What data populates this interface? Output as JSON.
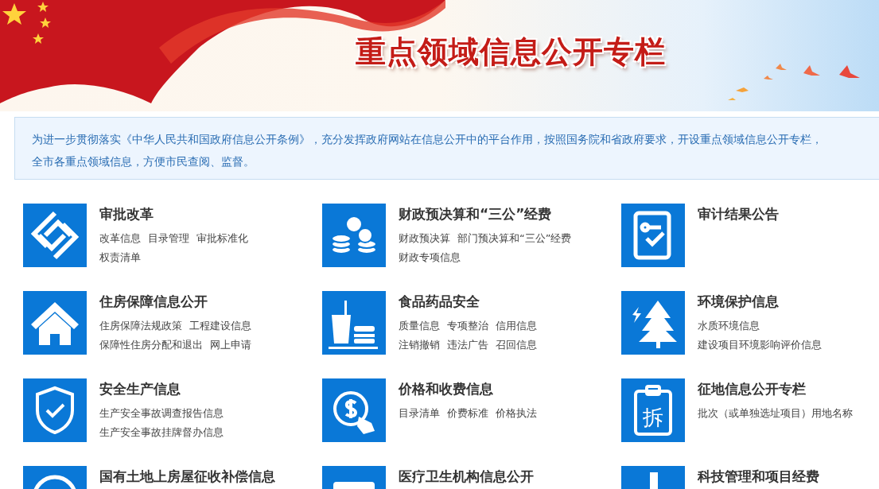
{
  "banner": {
    "title": "重点领域信息公开专栏"
  },
  "intro": {
    "lines": [
      "为进一步贯彻落实《中华人民共和国政府信息公开条例》，充分发挥政府网站在信息公开中的平台作用，按照国务院和省政府要求，开设重点领域信息公开专栏，",
      "全市各重点领域信息，方便市民查阅、监督。"
    ]
  },
  "sections": [
    {
      "title": "审批改革",
      "links": [
        "改革信息",
        "目录管理",
        "审批标准化",
        "权责清单"
      ]
    },
    {
      "title": "财政预决算和“三公”经费",
      "links": [
        "财政预决算",
        "部门预决算和“三公”经费",
        "财政专项信息"
      ]
    },
    {
      "title": "审计结果公告"
    },
    {
      "title": "住房保障信息公开",
      "links": [
        "住房保障法规政策",
        "工程建设信息",
        "保障性住房分配和退出",
        "网上申请"
      ]
    },
    {
      "title": "食品药品安全",
      "links": [
        "质量信息",
        "专项整治",
        "信用信息",
        "注销撤销",
        "违法广告",
        "召回信息"
      ]
    },
    {
      "title": "环境保护信息",
      "links": [
        "水质环境信息",
        "建设项目环境影响评价信息"
      ]
    },
    {
      "title": "安全生产信息",
      "links": [
        "生产安全事故调查报告信息",
        "生产安全事故挂牌督办信息"
      ]
    },
    {
      "title": "价格和收费信息",
      "links": [
        "目录清单",
        "价费标准",
        "价格执法"
      ]
    },
    {
      "title": "征地信息公开专栏",
      "links": [
        "批次（或单独选址项目）用地名称"
      ],
      "icon_glyph": "拆"
    },
    {
      "title": "国有土地上房屋征收补偿信息"
    },
    {
      "title": "医疗卫生机构信息公开"
    },
    {
      "title": "科技管理和项目经费"
    }
  ]
}
